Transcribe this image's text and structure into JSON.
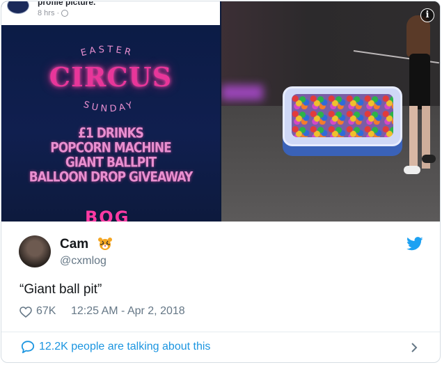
{
  "facebook_header": {
    "line1": "profile picture.",
    "time": "8 hrs ·"
  },
  "poster": {
    "easter": "EASTER",
    "circus": "CIRCUS",
    "sunday": "SUNDAY",
    "offers": [
      "£1 DRINKS",
      "POPCORN MACHINE",
      "GIANT BALLPIT",
      "BALLOON DROP GIVEAWAY"
    ],
    "logo_partial": "BOG"
  },
  "tweet": {
    "display_name": "Cam",
    "name_emoji": "tiger-face",
    "handle": "@cxmlog",
    "text": "“Giant ball pit”",
    "likes": "67K",
    "timestamp": "12:25 AM - Apr 2, 2018",
    "conversation": "12.2K people are talking about this"
  },
  "colors": {
    "twitter_blue": "#1da1f2",
    "link_blue": "#1b95e0",
    "neon_pink": "#e8369a",
    "muted": "#657786"
  }
}
